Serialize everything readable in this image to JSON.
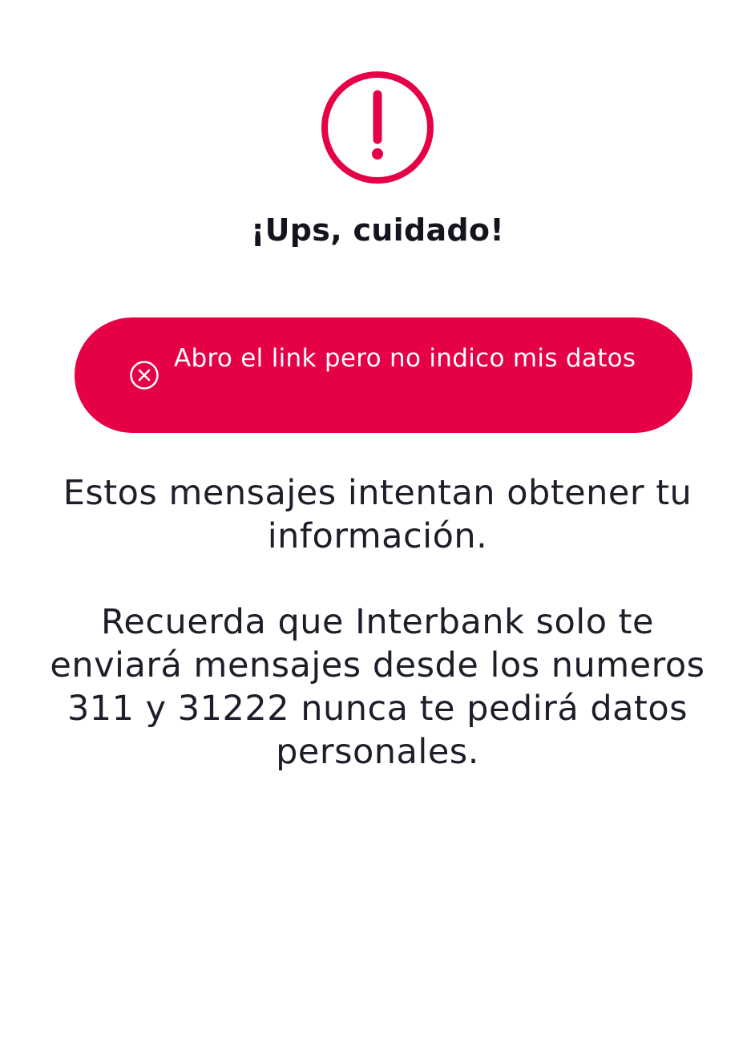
{
  "alert": {
    "icon": "exclamation-circle-icon",
    "color": "#e60046"
  },
  "title": "¡Ups, cuidado!",
  "option": {
    "icon": "x-circle-icon",
    "label": "Abro el link pero no indico mis datos",
    "background": "#e60046"
  },
  "messages": {
    "warning": "Estos mensajes intentan obtener tu información.",
    "reminder": "Recuerda que Interbank solo te enviará mensajes desde los numeros 311 y 31222 nunca te pedirá datos personales."
  }
}
